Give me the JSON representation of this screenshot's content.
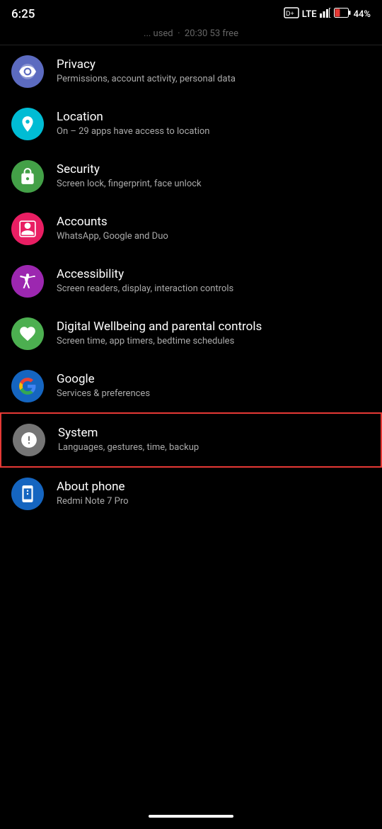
{
  "statusBar": {
    "time": "6:25",
    "lte": "LTE",
    "battery": "44%"
  },
  "topStrip": {
    "text": "... used · 20:30 53 free"
  },
  "items": [
    {
      "id": "privacy",
      "title": "Privacy",
      "subtitle": "Permissions, account activity, personal data",
      "iconColor": "#5c6bc0",
      "iconType": "eye-shield"
    },
    {
      "id": "location",
      "title": "Location",
      "subtitle": "On – 29 apps have access to location",
      "iconColor": "#00bcd4",
      "iconType": "location"
    },
    {
      "id": "security",
      "title": "Security",
      "subtitle": "Screen lock, fingerprint, face unlock",
      "iconColor": "#43a047",
      "iconType": "lock"
    },
    {
      "id": "accounts",
      "title": "Accounts",
      "subtitle": "WhatsApp, Google and Duo",
      "iconColor": "#e91e63",
      "iconType": "account"
    },
    {
      "id": "accessibility",
      "title": "Accessibility",
      "subtitle": "Screen readers, display, interaction controls",
      "iconColor": "#9c27b0",
      "iconType": "accessibility"
    },
    {
      "id": "digital-wellbeing",
      "title": "Digital Wellbeing and parental controls",
      "subtitle": "Screen time, app timers, bedtime schedules",
      "iconColor": "#4caf50",
      "iconType": "wellbeing"
    },
    {
      "id": "google",
      "title": "Google",
      "subtitle": "Services & preferences",
      "iconColor": "#1565c0",
      "iconType": "google"
    },
    {
      "id": "system",
      "title": "System",
      "subtitle": "Languages, gestures, time, backup",
      "iconColor": "#757575",
      "iconType": "system",
      "highlighted": true
    },
    {
      "id": "about-phone",
      "title": "About phone",
      "subtitle": "Redmi Note 7 Pro",
      "iconColor": "#1565c0",
      "iconType": "phone-info"
    }
  ]
}
